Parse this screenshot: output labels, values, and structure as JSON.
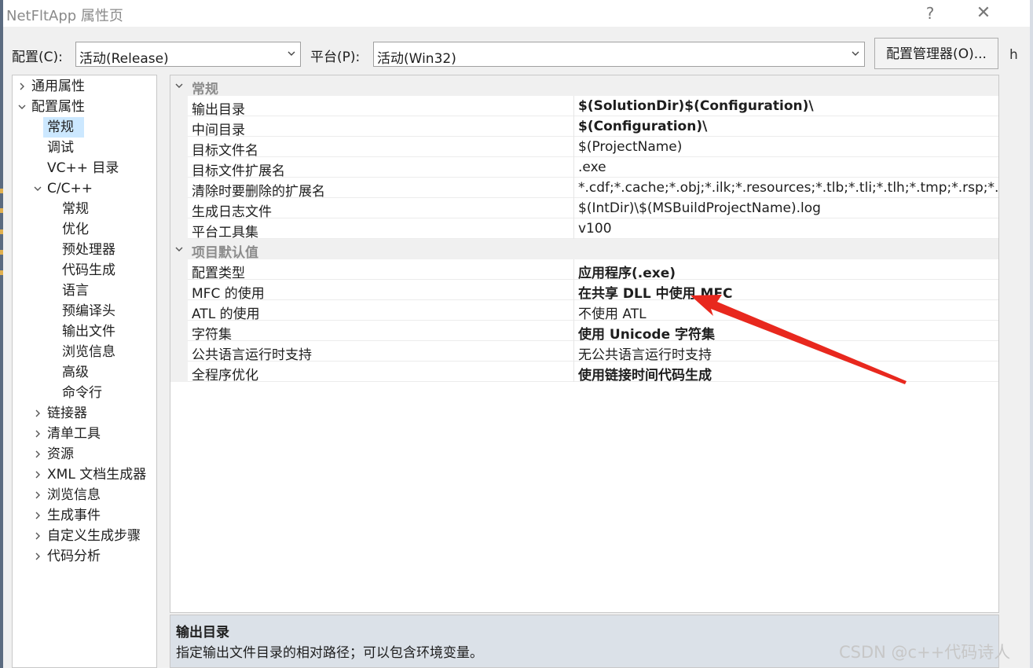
{
  "window": {
    "title": "NetFltApp 属性页",
    "help": "?",
    "close": "✕",
    "background_fragment": "h"
  },
  "toolbar": {
    "config_label": "配置(C):",
    "config_value": "活动(Release)",
    "platform_label": "平台(P):",
    "platform_value": "活动(Win32)",
    "config_manager_button": "配置管理器(O)..."
  },
  "tree": {
    "items": [
      {
        "label": "通用属性",
        "level": 0,
        "expander": "collapsed"
      },
      {
        "label": "配置属性",
        "level": 0,
        "expander": "expanded"
      },
      {
        "label": "常规",
        "level": 1,
        "selected": true
      },
      {
        "label": "调试",
        "level": 1
      },
      {
        "label": "VC++ 目录",
        "level": 1
      },
      {
        "label": "C/C++",
        "level": 1,
        "expander": "expanded"
      },
      {
        "label": "常规",
        "level": 2
      },
      {
        "label": "优化",
        "level": 2
      },
      {
        "label": "预处理器",
        "level": 2
      },
      {
        "label": "代码生成",
        "level": 2
      },
      {
        "label": "语言",
        "level": 2
      },
      {
        "label": "预编译头",
        "level": 2
      },
      {
        "label": "输出文件",
        "level": 2
      },
      {
        "label": "浏览信息",
        "level": 2
      },
      {
        "label": "高级",
        "level": 2
      },
      {
        "label": "命令行",
        "level": 2
      },
      {
        "label": "链接器",
        "level": 1,
        "expander": "collapsed"
      },
      {
        "label": "清单工具",
        "level": 1,
        "expander": "collapsed"
      },
      {
        "label": "资源",
        "level": 1,
        "expander": "collapsed"
      },
      {
        "label": "XML 文档生成器",
        "level": 1,
        "expander": "collapsed"
      },
      {
        "label": "浏览信息",
        "level": 1,
        "expander": "collapsed"
      },
      {
        "label": "生成事件",
        "level": 1,
        "expander": "collapsed"
      },
      {
        "label": "自定义生成步骤",
        "level": 1,
        "expander": "collapsed"
      },
      {
        "label": "代码分析",
        "level": 1,
        "expander": "collapsed"
      }
    ]
  },
  "grid": {
    "rows": [
      {
        "kind": "section",
        "label": "常规"
      },
      {
        "kind": "prop",
        "name": "输出目录",
        "value": "$(SolutionDir)$(Configuration)\\",
        "bold": true
      },
      {
        "kind": "prop",
        "name": "中间目录",
        "value": "$(Configuration)\\",
        "bold": true
      },
      {
        "kind": "prop",
        "name": "目标文件名",
        "value": "$(ProjectName)",
        "bold": false
      },
      {
        "kind": "prop",
        "name": "目标文件扩展名",
        "value": ".exe",
        "bold": false
      },
      {
        "kind": "prop",
        "name": "清除时要删除的扩展名",
        "value": "*.cdf;*.cache;*.obj;*.ilk;*.resources;*.tlb;*.tli;*.tlh;*.tmp;*.rsp;*.pgc",
        "bold": false
      },
      {
        "kind": "prop",
        "name": "生成日志文件",
        "value": "$(IntDir)\\$(MSBuildProjectName).log",
        "bold": false
      },
      {
        "kind": "prop",
        "name": "平台工具集",
        "value": "v100",
        "bold": false
      },
      {
        "kind": "section",
        "label": "项目默认值"
      },
      {
        "kind": "prop",
        "name": "配置类型",
        "value": "应用程序(.exe)",
        "bold": true
      },
      {
        "kind": "prop",
        "name": "MFC 的使用",
        "value": "在共享 DLL 中使用 MFC",
        "bold": true
      },
      {
        "kind": "prop",
        "name": "ATL 的使用",
        "value": "不使用 ATL",
        "bold": false
      },
      {
        "kind": "prop",
        "name": "字符集",
        "value": "使用 Unicode 字符集",
        "bold": true
      },
      {
        "kind": "prop",
        "name": "公共语言运行时支持",
        "value": "无公共语言运行时支持",
        "bold": false
      },
      {
        "kind": "prop",
        "name": "全程序优化",
        "value": "使用链接时间代码生成",
        "bold": true
      }
    ]
  },
  "description": {
    "title": "输出目录",
    "text": "指定输出文件目录的相对路径；可以包含环境变量。"
  },
  "annotation": {
    "color": "#e8281e"
  },
  "watermark": "CSDN @c++代码诗人"
}
